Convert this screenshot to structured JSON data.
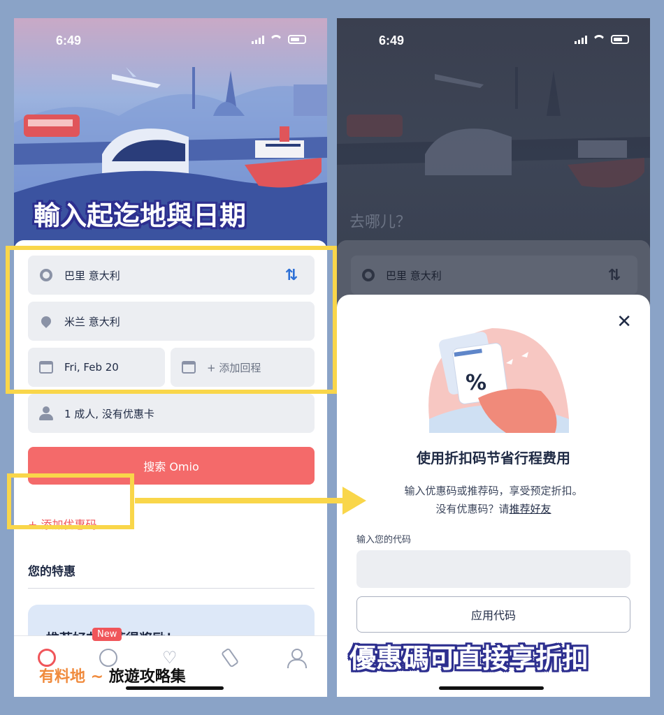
{
  "left_screen": {
    "status": {
      "time": "6:49"
    },
    "overlay_caption": "輸入起迄地與日期",
    "form": {
      "origin": "巴里 意大利",
      "destination": "米兰 意大利",
      "depart_date": "Fri, Feb 20",
      "return_placeholder": "+ 添加回程",
      "passengers": "1 成人, 没有优惠卡",
      "search_label": "搜索 Omio",
      "add_promo_label": "+ 添加优惠码"
    },
    "deals": {
      "title": "您的特惠",
      "refer_card_title": "推荐好友，获得奖励！"
    },
    "tabbar": {
      "new_badge": "New",
      "watermark_orange": "有料地 ~ ",
      "watermark_black": "旅遊攻略集"
    }
  },
  "right_screen": {
    "status": {
      "time": "6:49"
    },
    "where_prompt": "去哪儿？",
    "origin": "巴里 意大利",
    "modal": {
      "title": "使用折扣码节省行程费用",
      "desc_line1": "输入优惠码或推荐码，享受预定折扣。",
      "desc_line2_prefix": "没有优惠码？请",
      "desc_line2_link": "推荐好友",
      "code_label": "输入您的代码",
      "code_value": "",
      "apply_label": "应用代码",
      "illustration_symbol": "%"
    },
    "overlay_caption": "優惠碼可直接享折扣"
  },
  "colors": {
    "accent_red": "#f46a6a",
    "highlight_yellow": "#f9d64a",
    "caption_outline": "#2d2f8f",
    "swap_blue": "#2c6fd6"
  },
  "icons": [
    "circle-origin-icon",
    "map-pin-icon",
    "calendar-icon",
    "person-icon",
    "swap-icon",
    "close-icon",
    "home-icon",
    "compass-icon",
    "heart-icon",
    "ticket-icon",
    "profile-icon"
  ]
}
